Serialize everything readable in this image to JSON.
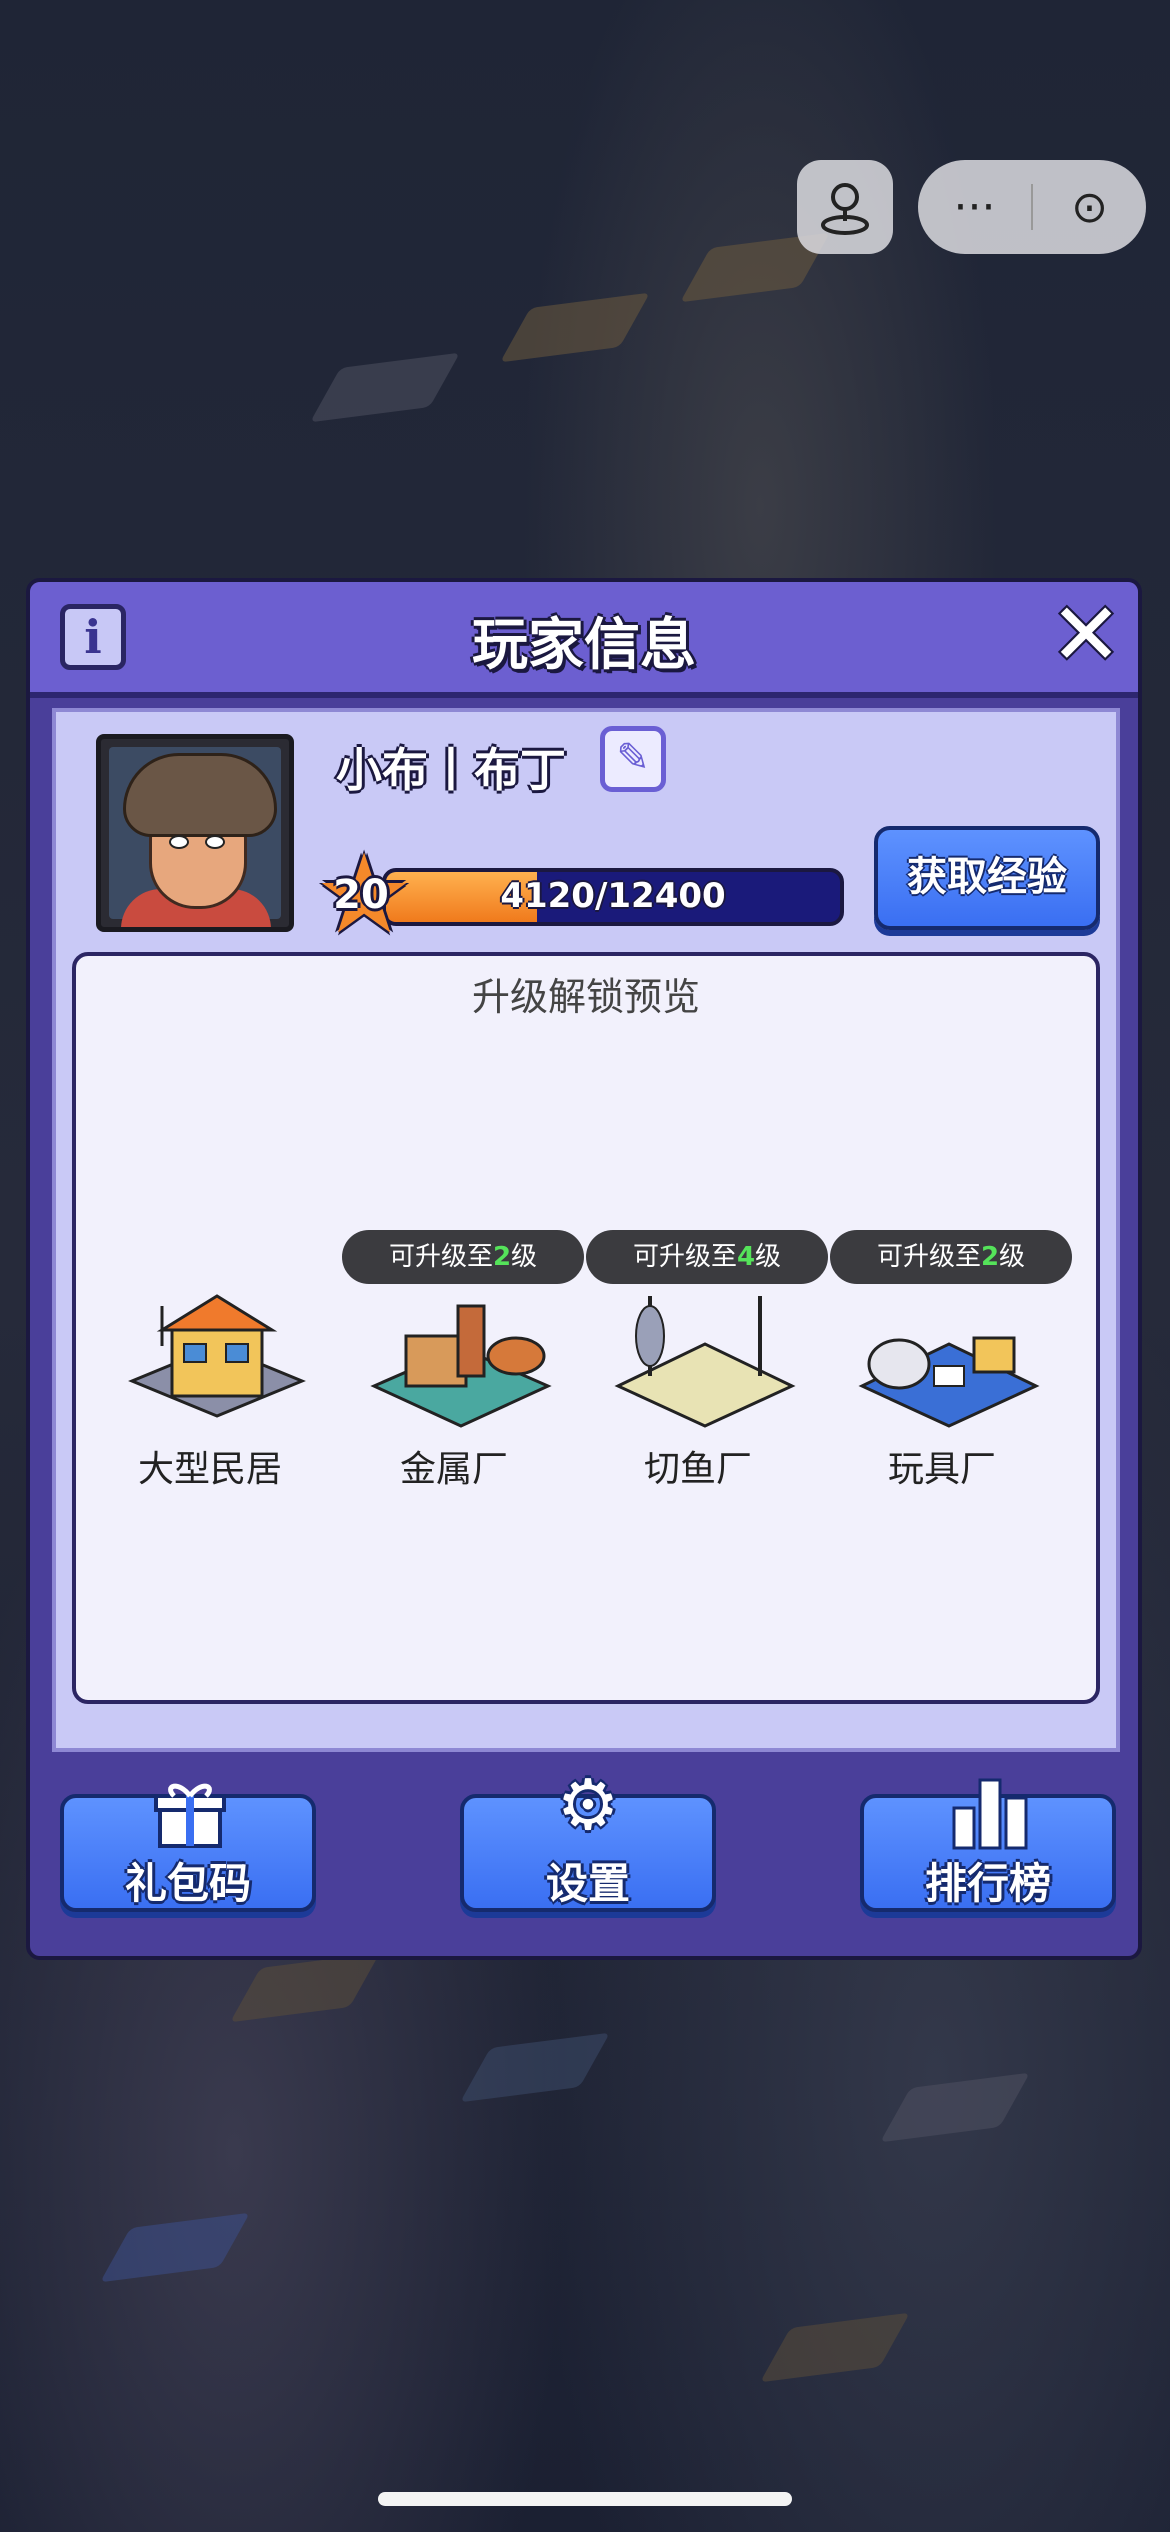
{
  "capsule": {
    "joystick_icon": "joystick-icon",
    "more_icon": "more-dots-icon",
    "more_label": "···",
    "close_icon": "target-circle-icon",
    "close_label": "⊙"
  },
  "panel": {
    "title": "玩家信息",
    "info_label": "i",
    "close_label": "✕"
  },
  "player": {
    "name": "小布丨布丁",
    "level": "20",
    "xp_text": "4120/12400",
    "xp_progress": 0.332,
    "get_xp_label": "获取经验"
  },
  "preview": {
    "title": "升级解锁预览",
    "items": [
      {
        "label": "大型民居",
        "badge_prefix": "",
        "badge_level": "",
        "badge_suffix": ""
      },
      {
        "label": "金属厂",
        "badge_prefix": "可升级至",
        "badge_level": "2",
        "badge_suffix": "级"
      },
      {
        "label": "切鱼厂",
        "badge_prefix": "可升级至",
        "badge_level": "4",
        "badge_suffix": "级"
      },
      {
        "label": "玩具厂",
        "badge_prefix": "可升级至",
        "badge_level": "2",
        "badge_suffix": "级"
      }
    ]
  },
  "buttons": {
    "gift_label": "礼包码",
    "settings_label": "设置",
    "ranking_label": "排行榜"
  },
  "colors": {
    "panel_bg": "#4a3f9a",
    "header_bg": "#6c5fd0",
    "button_blue": "#3a6ff2",
    "xp_orange": "#f07a1c",
    "badge_level_green": "#55e35a"
  }
}
